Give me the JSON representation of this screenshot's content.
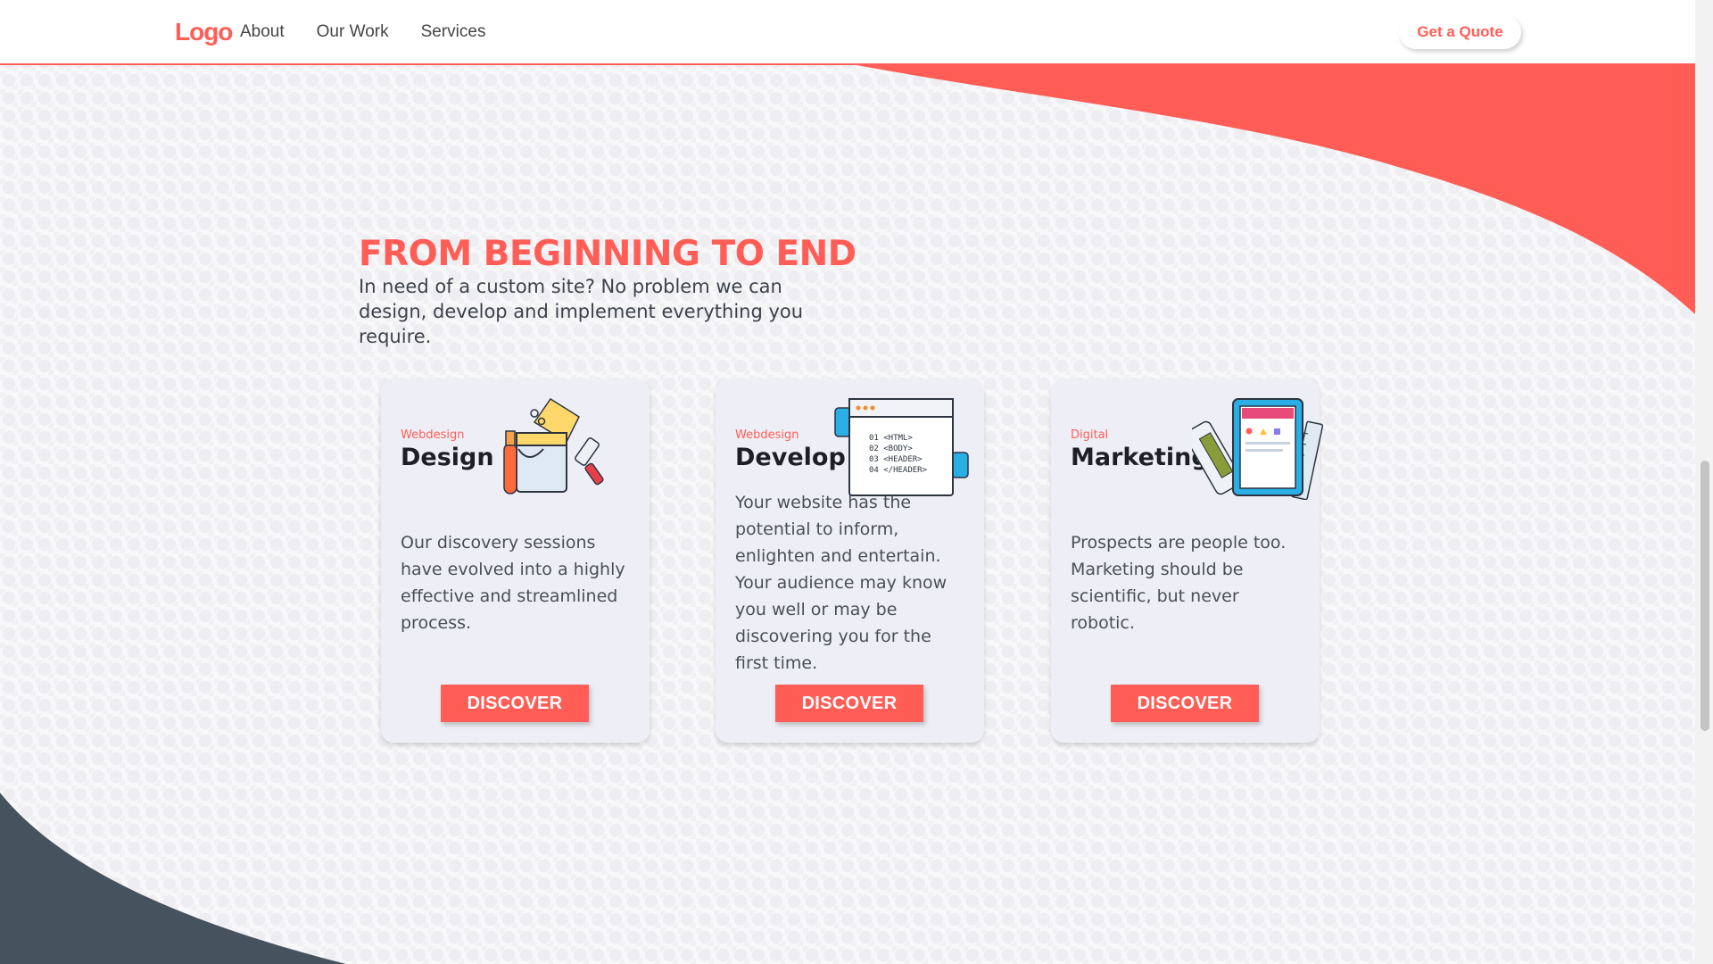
{
  "header": {
    "logo_text": "Logo",
    "nav": [
      {
        "label": "About"
      },
      {
        "label": "Our Work"
      },
      {
        "label": "Services"
      }
    ],
    "cta_label": "Get a Quote"
  },
  "intro": {
    "heading": "FROM BEGINNING TO END",
    "body": "In need of a custom site? No problem we can design, develop and implement everything you require."
  },
  "cards": [
    {
      "eyebrow": "Webdesign",
      "title": "Design",
      "icon": "paint-bucket-brush-icon",
      "description": "Our discovery sessions have evolved into a highly effective and streamlined process.",
      "button_label": "DISCOVER"
    },
    {
      "eyebrow": "Webdesign",
      "title": "Develop",
      "icon": "code-window-icon",
      "code_lines": [
        "01 <HTML>",
        "02 <BODY>",
        "03 <HEADER>",
        "04 </HEADER>"
      ],
      "description": "Your website has the potential to inform, enlighten and entertain. Your audience may know you well or may be discovering you for the first time.",
      "button_label": "DISCOVER"
    },
    {
      "eyebrow": "Digital",
      "title": "Marketing",
      "icon": "tablet-ruler-icon",
      "description": "Prospects are people too. Marketing should be scientific, but never robotic.",
      "button_label": "DISCOVER"
    }
  ],
  "colors": {
    "accent": "#ff5d55",
    "slate": "#47525f",
    "card_background": "#eeeff6",
    "heading_text": "#1d1f24"
  }
}
